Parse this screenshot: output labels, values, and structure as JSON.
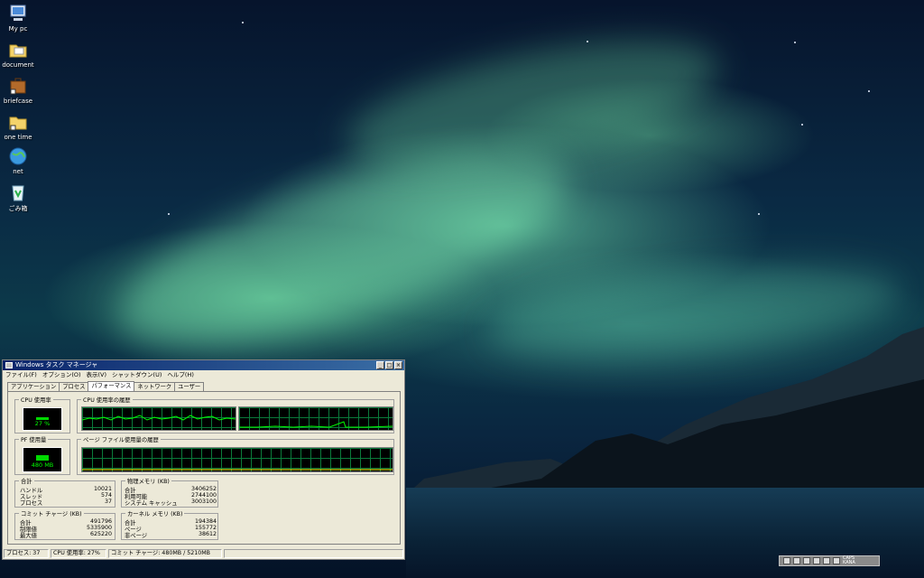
{
  "desktop_icons": [
    {
      "label": "My pc",
      "icon": "computer-icon"
    },
    {
      "label": "document",
      "icon": "folder-icon"
    },
    {
      "label": "briefcase",
      "icon": "briefcase-icon"
    },
    {
      "label": "one time",
      "icon": "folder-icon"
    },
    {
      "label": "net",
      "icon": "globe-icon"
    },
    {
      "label": "ごみ箱",
      "icon": "recycle-bin-icon"
    }
  ],
  "window": {
    "title": "Windows タスク マネージャ",
    "menu": [
      "ファイル(F)",
      "オプション(O)",
      "表示(V)",
      "シャットダウン(U)",
      "ヘルプ(H)"
    ],
    "tabs": [
      "アプリケーション",
      "プロセス",
      "パフォーマンス",
      "ネットワーク",
      "ユーザー"
    ],
    "active_tab": "パフォーマンス",
    "groups": {
      "cpu_usage": "CPU 使用率",
      "cpu_history": "CPU 使用率の履歴",
      "pf_usage": "PF 使用量",
      "pf_history": "ページ ファイル使用量の履歴",
      "totals": "合計",
      "physical": "物理メモリ (KB)",
      "commit": "コミット チャージ (KB)",
      "kernel": "カーネル メモリ (KB)"
    },
    "cpu_meter": "27 %",
    "cpu_percent": 27,
    "pf_meter": "480 MB",
    "totals": [
      {
        "label": "ハンドル",
        "value": "10021"
      },
      {
        "label": "スレッド",
        "value": "574"
      },
      {
        "label": "プロセス",
        "value": "37"
      }
    ],
    "physical": [
      {
        "label": "合計",
        "value": "3406252"
      },
      {
        "label": "利用可能",
        "value": "2744100"
      },
      {
        "label": "システム キャッシュ",
        "value": "3003100"
      }
    ],
    "commit": [
      {
        "label": "合計",
        "value": "491796"
      },
      {
        "label": "制限値",
        "value": "5335900"
      },
      {
        "label": "最大値",
        "value": "625220"
      }
    ],
    "kernel": [
      {
        "label": "合計",
        "value": "194384"
      },
      {
        "label": "ページ",
        "value": "155772"
      },
      {
        "label": "非ページ",
        "value": "38612"
      }
    ],
    "status": {
      "processes": "プロセス: 37",
      "cpu": "CPU 使用率: 27%",
      "commit": "コミット チャージ: 480MB / 5210MB"
    },
    "titlebar_buttons": [
      "_",
      "□",
      "×"
    ]
  },
  "tray": {
    "caps": "CAPS",
    "kana": "KANA"
  },
  "colors": {
    "graph_line": "#00ff00",
    "titlebar": "#0a246a"
  }
}
